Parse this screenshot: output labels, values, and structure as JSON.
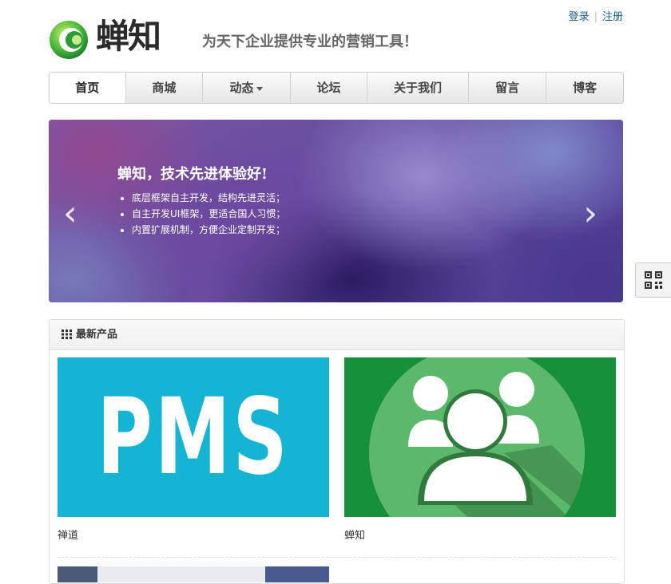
{
  "topbar": {
    "login_label": "登录",
    "register_label": "注册"
  },
  "header": {
    "logo_text": "蝉知",
    "slogan": "为天下企业提供专业的营销工具！"
  },
  "nav": {
    "items": [
      {
        "label": "首页",
        "active": true
      },
      {
        "label": "商城"
      },
      {
        "label": "动态",
        "has_dropdown": true
      },
      {
        "label": "论坛"
      },
      {
        "label": "关于我们"
      },
      {
        "label": "留言"
      },
      {
        "label": "博客"
      }
    ]
  },
  "banner": {
    "title": "蝉知，技术先进体验好!",
    "points": [
      "底层框架自主开发，结构先进灵活；",
      "自主开发UI框架，更适合国人习惯；",
      "内置扩展机制，方便企业定制开发；"
    ],
    "prev_icon": "chevron-left-icon",
    "next_icon": "chevron-right-icon"
  },
  "qr": {
    "icon": "qrcode-icon"
  },
  "products": {
    "heading": "最新产品",
    "items": [
      {
        "caption": "禅道",
        "image_text": "PMS",
        "image_color": "#15b4d3"
      },
      {
        "caption": "蝉知",
        "image_color": "#169039"
      }
    ]
  },
  "colors": {
    "link": "#1a5d8f",
    "accent_green": "#169039",
    "accent_cyan": "#15b4d3"
  }
}
